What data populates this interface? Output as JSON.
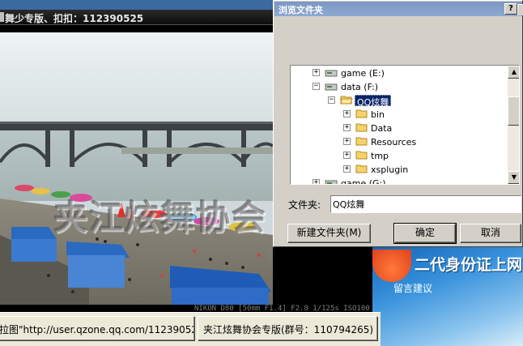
{
  "background_window": {
    "title": "舞少专版、扣扣：112390525",
    "statusbar": {
      "url_panel": "拉图\"http://user.qzone.qq.com/11239052",
      "group_panel": "夹江炫舞协会专版(群号：110794265)"
    },
    "photo": {
      "watermark": "夹江炫舞协会",
      "exif": "NIKON D80 [50mm F1.4] F2.8 1/125s ISO100"
    },
    "web_content": {
      "banner": "二代身份证上网",
      "link": "留言建议"
    }
  },
  "dialog": {
    "title": "浏览文件夹",
    "help_button": "?",
    "tree": [
      {
        "label": "game (E:)",
        "type": "drive",
        "level": 0,
        "expander": "+"
      },
      {
        "label": "data (F:)",
        "type": "drive",
        "level": 0,
        "expander": "−"
      },
      {
        "label": "QQ炫舞",
        "type": "folder-open",
        "level": 1,
        "expander": "−",
        "selected": true
      },
      {
        "label": "bin",
        "type": "folder",
        "level": 2,
        "expander": "+"
      },
      {
        "label": "Data",
        "type": "folder",
        "level": 2,
        "expander": "+"
      },
      {
        "label": "Resources",
        "type": "folder",
        "level": 2,
        "expander": "+"
      },
      {
        "label": "tmp",
        "type": "folder",
        "level": 2,
        "expander": "+"
      },
      {
        "label": "xsplugin",
        "type": "folder",
        "level": 2,
        "expander": "+"
      },
      {
        "label": "game (G:)",
        "type": "drive",
        "level": 0,
        "expander": "+"
      }
    ],
    "folder_label": "文件夹:",
    "folder_value": "QQ炫舞",
    "buttons": {
      "new_folder": "新建文件夹(M)",
      "ok": "确定",
      "cancel": "取消"
    }
  },
  "colors": {
    "selection": "#0a246a",
    "dialog_face": "#d4d0c8",
    "title_gradient": "#7a96c4"
  }
}
